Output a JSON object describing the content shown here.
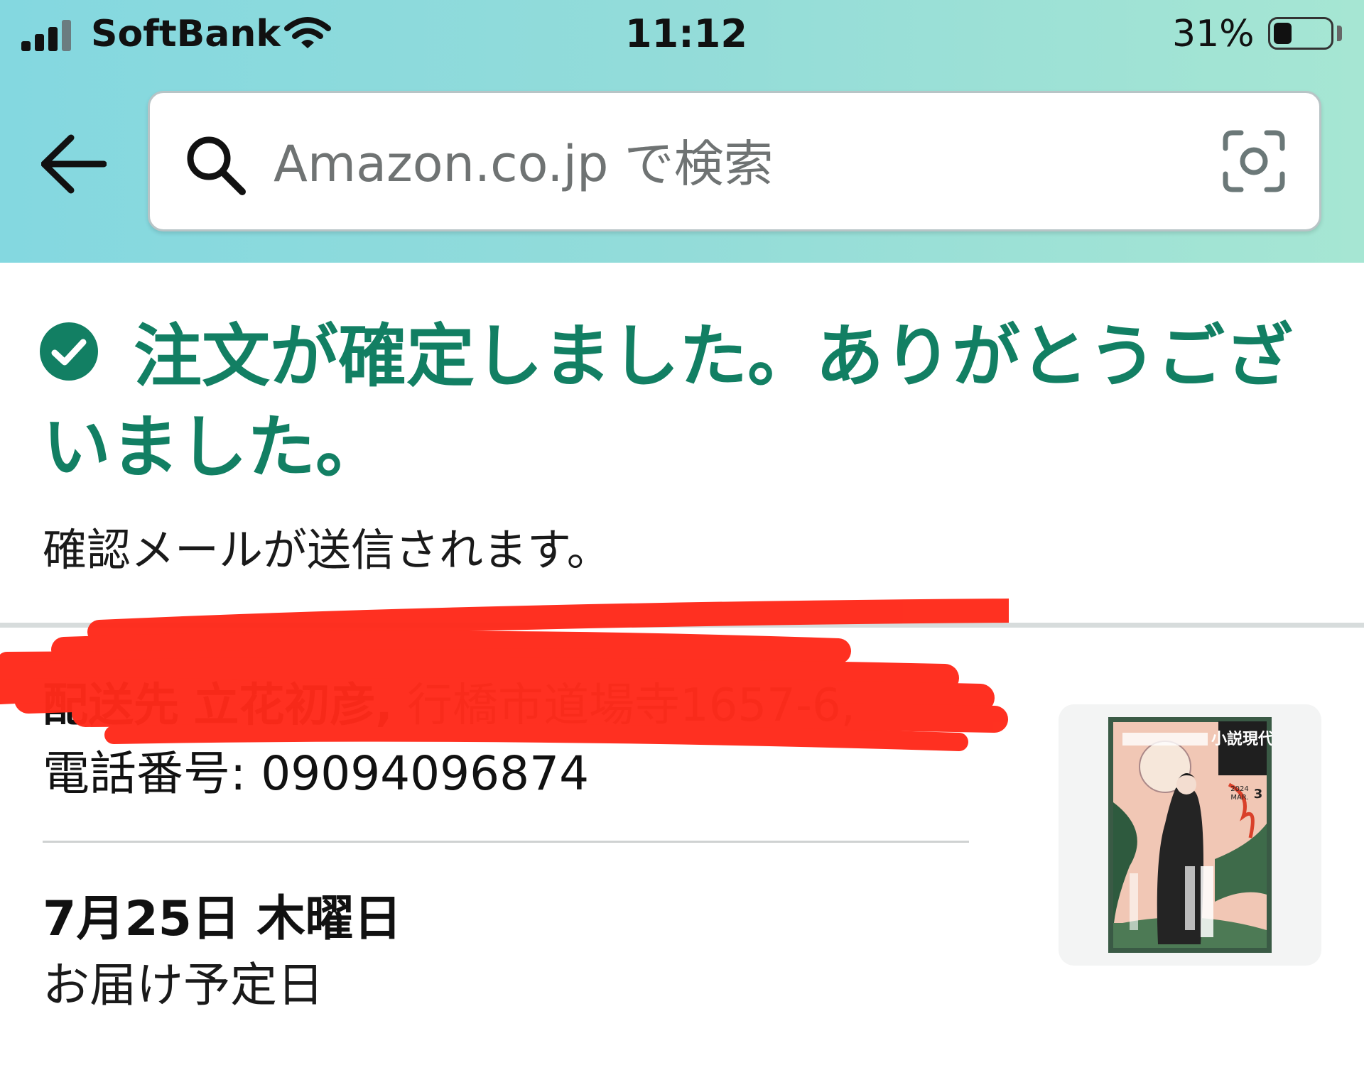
{
  "status_bar": {
    "carrier": "SoftBank",
    "time": "11:12",
    "battery_percent": "31%",
    "battery_level": 0.31,
    "signal_bars_filled": 3,
    "signal_bars_total": 4
  },
  "search": {
    "placeholder": "Amazon.co.jp で検索"
  },
  "confirmation": {
    "heading": "注文が確定しました。ありがとうございました。",
    "email_note": "確認メールが送信されます。",
    "accent_color": "#127f63"
  },
  "shipping": {
    "label": "配送先",
    "name": "立花初彦,",
    "address": "行橋市道場寺1657-6,",
    "phone": "電話番号: 09094096874",
    "redaction_color": "#ff2a1a"
  },
  "delivery": {
    "date": "7月25日 木曜日",
    "label": "お届け予定日"
  },
  "product": {
    "cover_title": "小説現代",
    "cover_year": "2024",
    "cover_month": "MAR.",
    "cover_issue": "3"
  },
  "icons": {
    "back": "arrow-left-icon",
    "search": "search-icon",
    "camera": "camera-scan-icon",
    "check": "check-circle-icon",
    "wifi": "wifi-icon",
    "signal": "signal-icon",
    "battery": "battery-icon"
  }
}
